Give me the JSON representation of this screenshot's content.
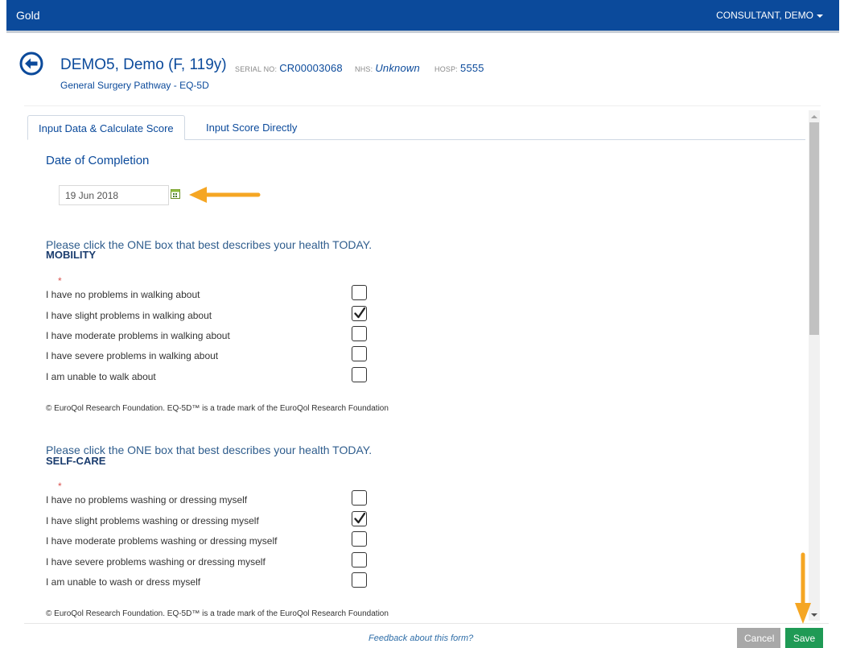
{
  "app": {
    "brand": "Gold",
    "user": "CONSULTANT, DEMO"
  },
  "patient": {
    "name": "DEMO5, Demo (F, 119y)",
    "serial_label": "SERIAL NO:",
    "serial": "CR00003068",
    "nhs_label": "NHS:",
    "nhs": "Unknown",
    "hosp_label": "HOSP:",
    "hosp": "5555",
    "pathway": "General Surgery Pathway - EQ-5D"
  },
  "tabs": [
    {
      "label": "Input Data & Calculate Score",
      "active": true
    },
    {
      "label": "Input Score Directly",
      "active": false
    }
  ],
  "form": {
    "date_title": "Date of Completion",
    "date_value": "19 Jun 2018",
    "sections": [
      {
        "question": "Please click the ONE box that best describes your health TODAY.",
        "dimension": "MOBILITY",
        "required_mark": "*",
        "options": [
          {
            "label": "I have no problems in walking about",
            "checked": false
          },
          {
            "label": "I have slight problems in walking about",
            "checked": true
          },
          {
            "label": "I have moderate problems in walking about",
            "checked": false
          },
          {
            "label": "I have severe problems in walking about",
            "checked": false
          },
          {
            "label": "I am unable to walk about",
            "checked": false
          }
        ],
        "copyright": "© EuroQol Research Foundation. EQ-5D™ is a trade mark of the EuroQol Research Foundation"
      },
      {
        "question": "Please click the ONE box that best describes your health TODAY.",
        "dimension": "SELF-CARE",
        "required_mark": "*",
        "options": [
          {
            "label": "I have no problems washing or dressing myself",
            "checked": false
          },
          {
            "label": "I have slight problems washing or dressing myself",
            "checked": true
          },
          {
            "label": "I have moderate problems washing or dressing myself",
            "checked": false
          },
          {
            "label": "I have severe problems washing or dressing myself",
            "checked": false
          },
          {
            "label": "I am unable to wash or dress myself",
            "checked": false
          }
        ],
        "copyright": "© EuroQol Research Foundation. EQ-5D™ is a trade mark of the EuroQol Research Foundation"
      }
    ]
  },
  "footer": {
    "feedback": "Feedback about this form?",
    "cancel": "Cancel",
    "save": "Save"
  },
  "colors": {
    "navbar": "#0b4a9b",
    "accent": "#0b4a9b",
    "highlight_arrow": "#f5a623",
    "save": "#1f9a55",
    "cancel": "#a8a8a8",
    "required": "#d9534f"
  }
}
